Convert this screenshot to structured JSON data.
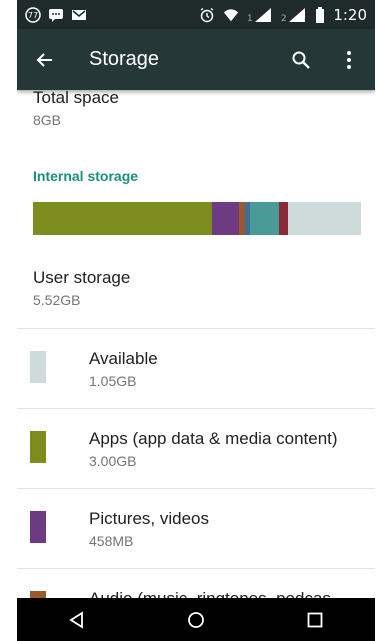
{
  "status_bar": {
    "time": "1:20",
    "left_icons": [
      "notification-77-icon",
      "chat-message-icon",
      "gmail-icon"
    ],
    "right_icons": [
      "alarm-icon",
      "wifi-icon",
      "signal-1-icon",
      "signal-2-icon",
      "battery-icon"
    ],
    "sim1": "1",
    "sim2": "2",
    "badge": "77"
  },
  "toolbar": {
    "title": "Storage",
    "back_icon": "arrow-left-icon",
    "search_icon": "search-icon",
    "more_icon": "more-vert-icon"
  },
  "total_space": {
    "label": "Total space",
    "value": "8GB"
  },
  "internal_storage": {
    "header": "Internal storage",
    "bar_segments": [
      {
        "name": "apps",
        "color": "#7c8c1f",
        "fraction": 0.545
      },
      {
        "name": "pictures",
        "color": "#6e3a82",
        "fraction": 0.082
      },
      {
        "name": "audio",
        "color": "#9c5a2a",
        "fraction": 0.018
      },
      {
        "name": "downloads",
        "color": "#3e6f9b",
        "fraction": 0.018
      },
      {
        "name": "cached",
        "color": "#4a9a98",
        "fraction": 0.088
      },
      {
        "name": "misc",
        "color": "#8a2a36",
        "fraction": 0.028
      },
      {
        "name": "available",
        "color": "#cfdada",
        "fraction": 0.221
      }
    ]
  },
  "user_storage": {
    "label": "User storage",
    "value": "5.52GB"
  },
  "categories": [
    {
      "label": "Available",
      "value": "1.05GB",
      "color": "#cfdada"
    },
    {
      "label": "Apps (app data & media content)",
      "value": "3.00GB",
      "color": "#7c8c1f"
    },
    {
      "label": "Pictures, videos",
      "value": "458MB",
      "color": "#6e3a82"
    },
    {
      "label": "Audio (music, ringtones, podcas",
      "value": "",
      "color": "#9c5a2a"
    }
  ],
  "nav_bar": {
    "back_icon": "triangle-back-icon",
    "home_icon": "circle-home-icon",
    "recents_icon": "square-recents-icon"
  }
}
